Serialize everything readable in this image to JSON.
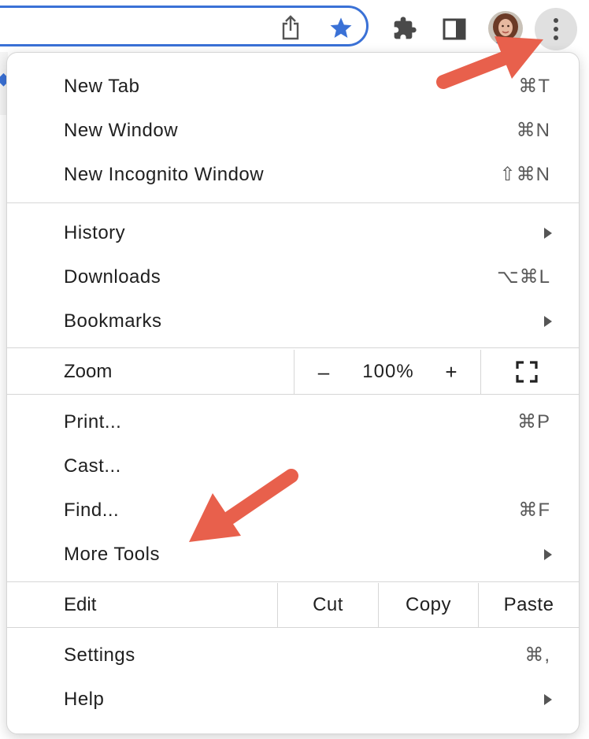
{
  "toolbar": {
    "icons": [
      "share-icon",
      "bookmark-star-icon",
      "extensions-icon",
      "side-panel-icon",
      "avatar",
      "more-options-icon"
    ]
  },
  "menu": {
    "group1": [
      {
        "label": "New Tab",
        "shortcut": "⌘T"
      },
      {
        "label": "New Window",
        "shortcut": "⌘N"
      },
      {
        "label": "New Incognito Window",
        "shortcut": "⇧⌘N"
      }
    ],
    "group2": [
      {
        "label": "History",
        "shortcut": ""
      },
      {
        "label": "Downloads",
        "shortcut": "⌥⌘L"
      },
      {
        "label": "Bookmarks",
        "shortcut": ""
      }
    ],
    "zoom": {
      "label": "Zoom",
      "minus": "–",
      "value": "100%",
      "plus": "+"
    },
    "group3": [
      {
        "label": "Print...",
        "shortcut": "⌘P"
      },
      {
        "label": "Cast...",
        "shortcut": ""
      },
      {
        "label": "Find...",
        "shortcut": "⌘F"
      },
      {
        "label": "More Tools",
        "shortcut": ""
      }
    ],
    "edit": {
      "label": "Edit",
      "cut": "Cut",
      "copy": "Copy",
      "paste": "Paste"
    },
    "group4": [
      {
        "label": "Settings",
        "shortcut": "⌘,"
      },
      {
        "label": "Help",
        "shortcut": ""
      }
    ]
  },
  "colors": {
    "accent": "#3a71d6",
    "annotation_arrow": "#e8604c"
  }
}
